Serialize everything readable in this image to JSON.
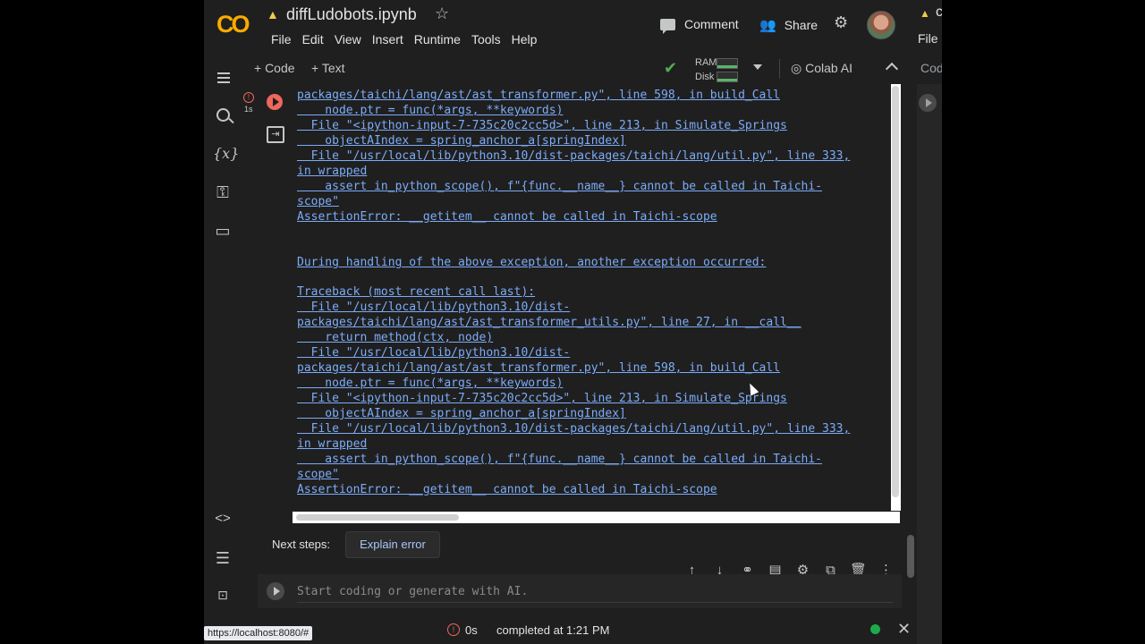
{
  "app": {
    "logo": "CO",
    "notebook_title": "diffLudobots.ipynb",
    "drive_icon": "drive-icon",
    "star_icon": "star-icon"
  },
  "menu": [
    "File",
    "Edit",
    "View",
    "Insert",
    "Runtime",
    "Tools",
    "Help"
  ],
  "header_actions": {
    "comment": "Comment",
    "share": "Share"
  },
  "toolbar": {
    "add_code": "+ Code",
    "add_text": "+ Text",
    "ram_label": "RAM",
    "disk_label": "Disk",
    "colab_ai": "Colab AI"
  },
  "sidebar": {
    "icons": [
      "table-of-contents-icon",
      "search-icon",
      "variables-icon",
      "secrets-key-icon",
      "files-folder-icon",
      "code-snippets-icon",
      "command-palette-icon",
      "terminal-icon"
    ],
    "variables_glyph": "{x}"
  },
  "cell": {
    "exec_time": "1s",
    "output_lines": [
      "packages/taichi/lang/ast/ast_transformer.py\", line 598, in build_Call",
      "    node.ptr = func(*args, **keywords)",
      "  File \"<ipython-input-7-735c20c2cc5d>\", line 213, in Simulate_Springs",
      "    objectAIndex = spring_anchor_a[springIndex]",
      "  File \"/usr/local/lib/python3.10/dist-packages/taichi/lang/util.py\", line 333,",
      "in wrapped",
      "    assert in_python_scope(), f\"{func.__name__} cannot be called in Taichi-",
      "scope\"",
      "AssertionError: __getitem__ cannot be called in Taichi-scope",
      "",
      "",
      "During handling of the above exception, another exception occurred:",
      "",
      "Traceback (most recent call last):",
      "  File \"/usr/local/lib/python3.10/dist-",
      "packages/taichi/lang/ast/ast_transformer_utils.py\", line 27, in __call__",
      "    return method(ctx, node)",
      "  File \"/usr/local/lib/python3.10/dist-",
      "packages/taichi/lang/ast/ast_transformer.py\", line 598, in build_Call",
      "    node.ptr = func(*args, **keywords)",
      "  File \"<ipython-input-7-735c20c2cc5d>\", line 213, in Simulate_Springs",
      "    objectAIndex = spring_anchor_a[springIndex]",
      "  File \"/usr/local/lib/python3.10/dist-packages/taichi/lang/util.py\", line 333,",
      "in wrapped",
      "    assert in_python_scope(), f\"{func.__name__} cannot be called in Taichi-",
      "scope\"",
      "AssertionError: __getitem__ cannot be called in Taichi-scope"
    ]
  },
  "next_steps": {
    "label": "Next steps:",
    "explain_button": "Explain error"
  },
  "cell_tools": [
    "move-up-icon",
    "move-down-icon",
    "link-icon",
    "comment-icon",
    "settings-icon",
    "mirror-cell-icon",
    "delete-icon",
    "more-options-icon"
  ],
  "new_cell": {
    "placeholder": "Start coding or generate with AI."
  },
  "status": {
    "url_tooltip": "https://localhost:8080/#",
    "duration": "0s",
    "message": "completed at 1:21 PM"
  },
  "peek": {
    "title_fragment": "c",
    "menu_fragment": "File",
    "toolbar_fragment": "Cod"
  },
  "colors": {
    "accent_blue": "#7cacf8",
    "error_red": "#ee675c",
    "status_green": "#1eaa4a",
    "logo_orange": "#f9ab00"
  }
}
